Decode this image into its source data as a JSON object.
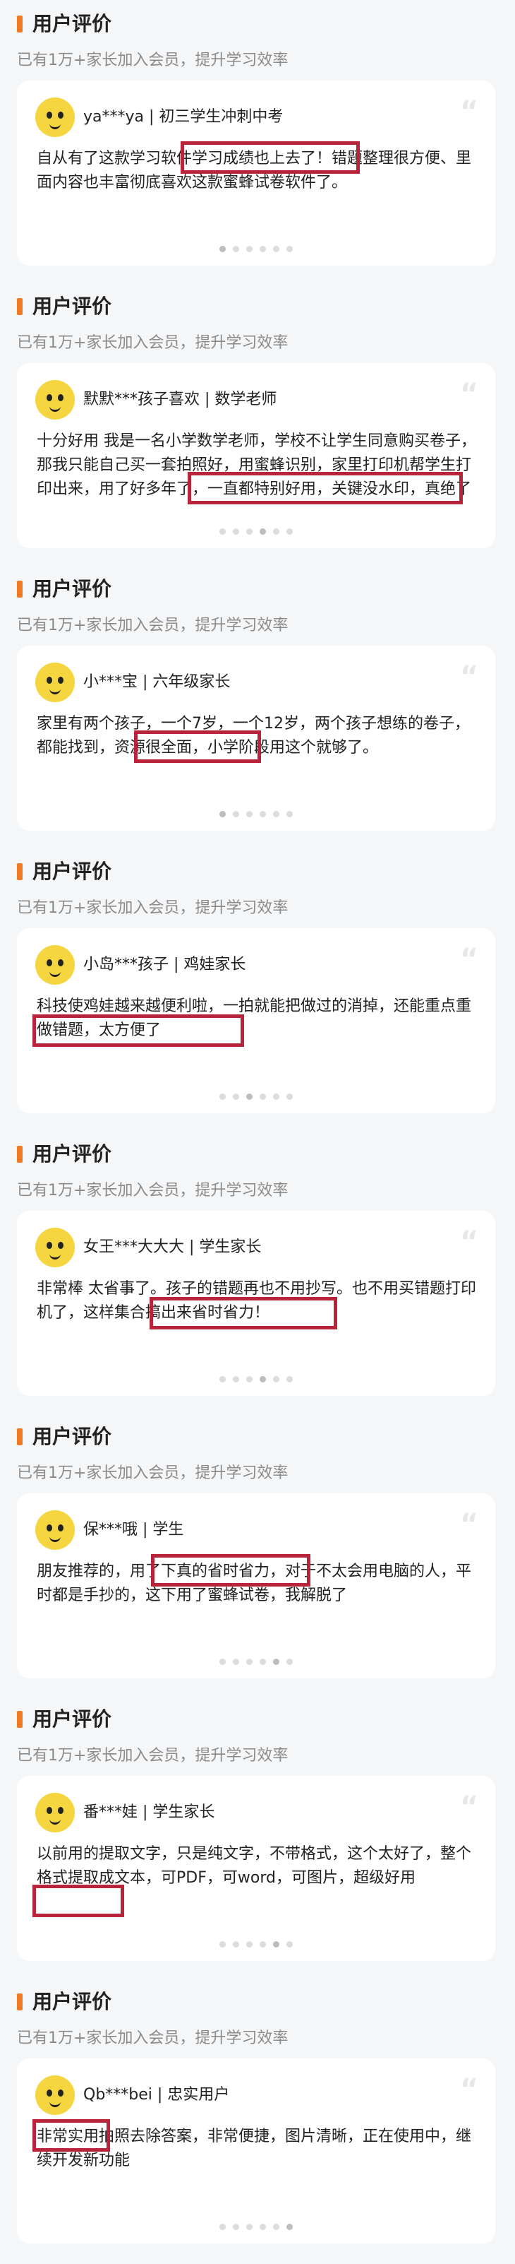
{
  "colors": {
    "accent": "#f07a24",
    "highlight": "#b8243a",
    "card": "#ffffff",
    "background": "#f5f6f8"
  },
  "quote_icon": "“",
  "sections": [
    {
      "title": "用户评价",
      "subtitle": "已有1万+家长加入会员，提升学习效率",
      "user": "ya***ya | 初三学生冲刺中考",
      "review": "自从有了这款学习软件学习成绩也上去了！错题整理很方便、里面内容也丰富彻底喜欢这款蜜蜂试卷软件了。"
    },
    {
      "title": "用户评价",
      "subtitle": "已有1万+家长加入会员，提升学习效率",
      "user": "默默***孩子喜欢 | 数学老师",
      "review": "十分好用 我是一名小学数学老师，学校不让学生同意购买卷子，那我只能自己买一套拍照好，用蜜蜂识别，家里打印机帮学生打印出来，用了好多年了，一直都特别好用，关键没水印，真绝了"
    },
    {
      "title": "用户评价",
      "subtitle": "已有1万+家长加入会员，提升学习效率",
      "user": "小***宝 | 六年级家长",
      "review": "家里有两个孩子，一个7岁，一个12岁，两个孩子想练的卷子，都能找到，资源很全面，小学阶段用这个就够了。"
    },
    {
      "title": "用户评价",
      "subtitle": "已有1万+家长加入会员，提升学习效率",
      "user": "小岛***孩子 | 鸡娃家长",
      "review": "科技使鸡娃越来越便利啦，一拍就能把做过的消掉，还能重点重做错题，太方便了"
    },
    {
      "title": "用户评价",
      "subtitle": "已有1万+家长加入会员，提升学习效率",
      "user": "女王***大大大 | 学生家长",
      "review": "非常棒 太省事了。孩子的错题再也不用抄写。也不用买错题打印机了，这样集合搞出来省时省力！"
    },
    {
      "title": "用户评价",
      "subtitle": "已有1万+家长加入会员，提升学习效率",
      "user": "保***哦 | 学生",
      "review": "朋友推荐的，用了下真的省时省力，对于不太会用电脑的人，平时都是手抄的，这下用了蜜蜂试卷，我解脱了"
    },
    {
      "title": "用户评价",
      "subtitle": "已有1万+家长加入会员，提升学习效率",
      "user": "番***娃 | 学生家长",
      "review": "以前用的提取文字，只是纯文字，不带格式，这个太好了，整个格式提取成文本，可PDF，可word，可图片，超级好用"
    },
    {
      "title": "用户评价",
      "subtitle": "已有1万+家长加入会员，提升学习效率",
      "user": "Qb***bei | 忠实用户",
      "review": "非常实用拍照去除答案，非常便捷，图片清晰，正在使用中，继续开发新功能"
    }
  ]
}
